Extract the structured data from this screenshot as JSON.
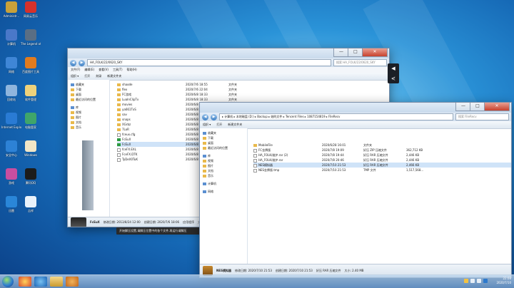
{
  "desktop": {
    "icons": [
      {
        "label": "Administr...",
        "color": "#c9a13a"
      },
      {
        "label": "网易云音乐",
        "color": "#d6312b"
      },
      {
        "label": "计算机",
        "color": "#4a78c9"
      },
      {
        "label": "The Legend of Heroes:...",
        "color": "#5a6e84"
      },
      {
        "label": "网络",
        "color": "#3f86d6"
      },
      {
        "label": "百度图片工具",
        "color": "#e07b1f"
      },
      {
        "label": "回收站",
        "color": "#8fb5dd"
      },
      {
        "label": "软件管理",
        "color": "#efd27b"
      },
      {
        "label": "Internet Explorer",
        "color": "#2a7bd4"
      },
      {
        "label": "电脑管家",
        "color": "#3fa56b"
      },
      {
        "label": "安全中心",
        "color": "#2d82d6"
      },
      {
        "label": "Windows",
        "color": "#f1e6c7"
      },
      {
        "label": "游戏",
        "color": "#c84ea0"
      },
      {
        "label": "腾讯QQ",
        "color": "#1c1c1c"
      },
      {
        "label": "迅雷",
        "color": "#2a86d8"
      },
      {
        "label": "吉祥",
        "color": "#e9f2fb"
      }
    ]
  },
  "window_back": {
    "path": "HA_FOLK/22/0620_SKY",
    "search": "搜索 HA_FOLK/22/0620_SKY",
    "menu": [
      "文件(F)",
      "编辑(E)",
      "查看(V)",
      "工具(T)",
      "帮助(H)"
    ],
    "toolbar": [
      "组织 ▾",
      "打开",
      "刻录",
      "新建文件夹"
    ],
    "nav": [
      {
        "label": "收藏夹",
        "hdr": true
      },
      {
        "label": "下载",
        "hdr": false
      },
      {
        "label": "桌面",
        "hdr": false
      },
      {
        "label": "最近访问的位置",
        "hdr": false
      },
      {
        "label": "库",
        "hdr": true
      },
      {
        "label": "视频",
        "hdr": false
      },
      {
        "label": "图片",
        "hdr": false
      },
      {
        "label": "文档",
        "hdr": false
      },
      {
        "label": "音乐",
        "hdr": false
      }
    ],
    "files": [
      {
        "name": "shaode",
        "date": "2020/7/6 18:55",
        "type": "文件夹",
        "kind": "folder",
        "sel": false
      },
      {
        "name": "flex",
        "date": "2020/7/6 22:04",
        "type": "文件夹",
        "kind": "folder",
        "sel": false
      },
      {
        "name": "FC游戏",
        "date": "2020/6/8 18:33",
        "type": "文件夹",
        "kind": "folder",
        "sel": false
      },
      {
        "name": "LuaInClipTx",
        "date": "2020/6/8 18:33",
        "type": "文件夹",
        "kind": "folder",
        "sel": false
      },
      {
        "name": "movies",
        "date": "2020/6/8 18:33",
        "type": "文件夹",
        "kind": "folder",
        "sel": false
      },
      {
        "name": "ya661TxS",
        "date": "2020/6/8 18:33",
        "type": "文件夹",
        "kind": "folder",
        "sel": false
      },
      {
        "name": "sav",
        "date": "2020/6/8 18:33",
        "type": "文件夹",
        "kind": "folder",
        "sel": false
      },
      {
        "name": "snaps",
        "date": "2020/6/8 18:33",
        "type": "文件夹",
        "kind": "folder",
        "sel": false
      },
      {
        "name": "XGrbz",
        "date": "2020/6/8 18:33",
        "type": "文件夹",
        "kind": "folder",
        "sel": false
      },
      {
        "name": "7LoR",
        "date": "2020/6/8 18:33",
        "type": "文件夹",
        "kind": "folder",
        "sel": false
      },
      {
        "name": "fceux.cfg",
        "date": "2020/6/8 18:33",
        "type": "CFG 文件",
        "kind": "file",
        "sel": false
      },
      {
        "name": "FcEuX",
        "date": "2020/6/8 18:33",
        "type": "应用程序",
        "kind": "exe",
        "sel": false
      },
      {
        "name": "FcEuX",
        "date": "2020/6/8 18:33",
        "type": "应用程序",
        "kind": "exe",
        "sel": true
      },
      {
        "name": "fceFX.EXL",
        "date": "2020/6/8 18:33",
        "type": "文件",
        "kind": "file",
        "sel": false
      },
      {
        "name": "FceFX.DTK",
        "date": "2020/6/8 18:33",
        "type": "文件",
        "kind": "file",
        "sel": false
      },
      {
        "name": "TyDeX0TuK",
        "date": "2020/6/8 18:33",
        "type": "文件",
        "kind": "file",
        "sel": false
      }
    ],
    "status": {
      "name": "FcEuX",
      "detail1": "修改日期: 2013/8/24 12:00",
      "detail2": "创建日期: 2020/7/6 18:06",
      "detail3": "应用程序",
      "detail4": "大小: 870 KB"
    }
  },
  "window_front": {
    "path": "▸ 计算机 ▸ 本地磁盘 (D:) ▸ Backup ▸ 她的文件 ▸ Tencent Files ▸ 1087154819 ▸ FileRecv",
    "search": "搜索 FileRecv",
    "toolbar": [
      "组织 ▾",
      "打开",
      "新建文件夹"
    ],
    "nav": [
      {
        "label": "收藏夹",
        "hdr": true
      },
      {
        "label": "下载",
        "hdr": false
      },
      {
        "label": "桌面",
        "hdr": false
      },
      {
        "label": "最近访问的位置",
        "hdr": false
      },
      {
        "label": "库",
        "hdr": true
      },
      {
        "label": "视频",
        "hdr": false
      },
      {
        "label": "图片",
        "hdr": false
      },
      {
        "label": "文档",
        "hdr": false
      },
      {
        "label": "音乐",
        "hdr": false
      },
      {
        "label": "计算机",
        "hdr": true
      },
      {
        "label": "网络",
        "hdr": true
      }
    ],
    "files": [
      {
        "name": "MobileFile",
        "date": "2020/6/28 16:01",
        "type": "文件夹",
        "size": "",
        "kind": "folder",
        "sel": false
      },
      {
        "name": "FC金牌版",
        "date": "2020/7/8 19:09",
        "type": "好压 ZIP 压缩文件",
        "size": "362,712 KB",
        "kind": "file",
        "sel": false
      },
      {
        "name": "HA_FOLK/维护.rar (2)",
        "date": "2020/7/8 19:44",
        "type": "好压 RAR 压缩文件",
        "size": "2,446 KB",
        "kind": "file",
        "sel": false
      },
      {
        "name": "HA_FOLK/维护.rar",
        "date": "2020/7/8 20:46",
        "type": "好压 RAR 压缩文件",
        "size": "2,446 KB",
        "kind": "file",
        "sel": false
      },
      {
        "name": "NES模拟器",
        "date": "2020/7/10 21:53",
        "type": "好压 RAR 压缩文件",
        "size": "2,466 KB",
        "kind": "file",
        "sel": true
      },
      {
        "name": "NES金牌版.tmp",
        "date": "2020/7/10 21:53",
        "type": "TMP 文件",
        "size": "1,517,568...",
        "kind": "file",
        "sel": false
      }
    ],
    "status": {
      "name": "NES模拟器",
      "detail1": "修改日期: 2020/7/10 21:53",
      "detail2": "创建日期: 2020/7/10 21:53",
      "detail3": "好压 RAR 压缩文件",
      "detail4": "大小: 2.40 MB"
    }
  },
  "tooltip": "开始解压设置,请解压位置中的各个文件,再运行请解压",
  "gadget": {
    "top": "◀",
    "bottom": "⋞"
  },
  "taskbar": {
    "time": "22:08",
    "date": "2020/7/10"
  }
}
